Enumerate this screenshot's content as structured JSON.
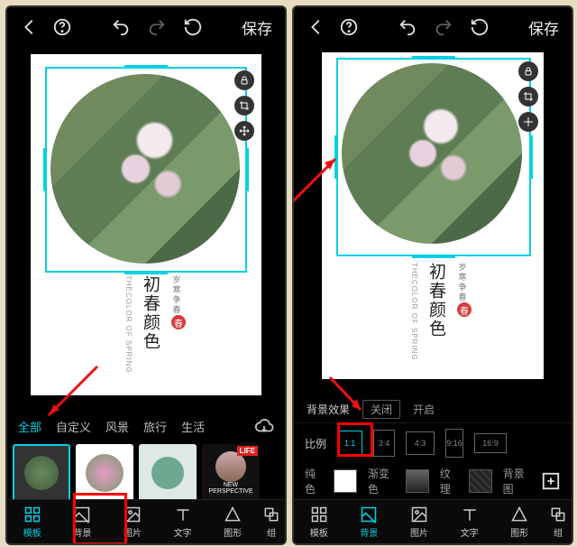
{
  "topbar": {
    "save": "保存"
  },
  "caption": {
    "small": "岁寒争春",
    "large": "初春颜色",
    "en": "THECOLOR OF SPRING",
    "seal": "春"
  },
  "leftPanel": {
    "filterTabs": [
      "全部",
      "自定义",
      "风景",
      "旅行",
      "生活"
    ],
    "filterActive": 0,
    "thumb4_top": "NEW",
    "thumb4_mid": "PERSPECTIVE",
    "thumb4_life": "LIFE"
  },
  "rightPanel": {
    "bgfx_label": "背景效果",
    "bgfx_off": "关闭",
    "bgfx_on": "开启",
    "ratio_label": "比例",
    "ratios": [
      "1:1",
      "3:4",
      "4:3",
      "9:16",
      "16:9"
    ],
    "ratio_active": 0,
    "color_label": "纯色",
    "grad": "渐变色",
    "tex": "纹理",
    "bgimg": "背景图"
  },
  "nav": {
    "items": [
      "模板",
      "背景",
      "图片",
      "文字",
      "图形",
      "组"
    ],
    "left_active": 0,
    "right_active": 1
  }
}
